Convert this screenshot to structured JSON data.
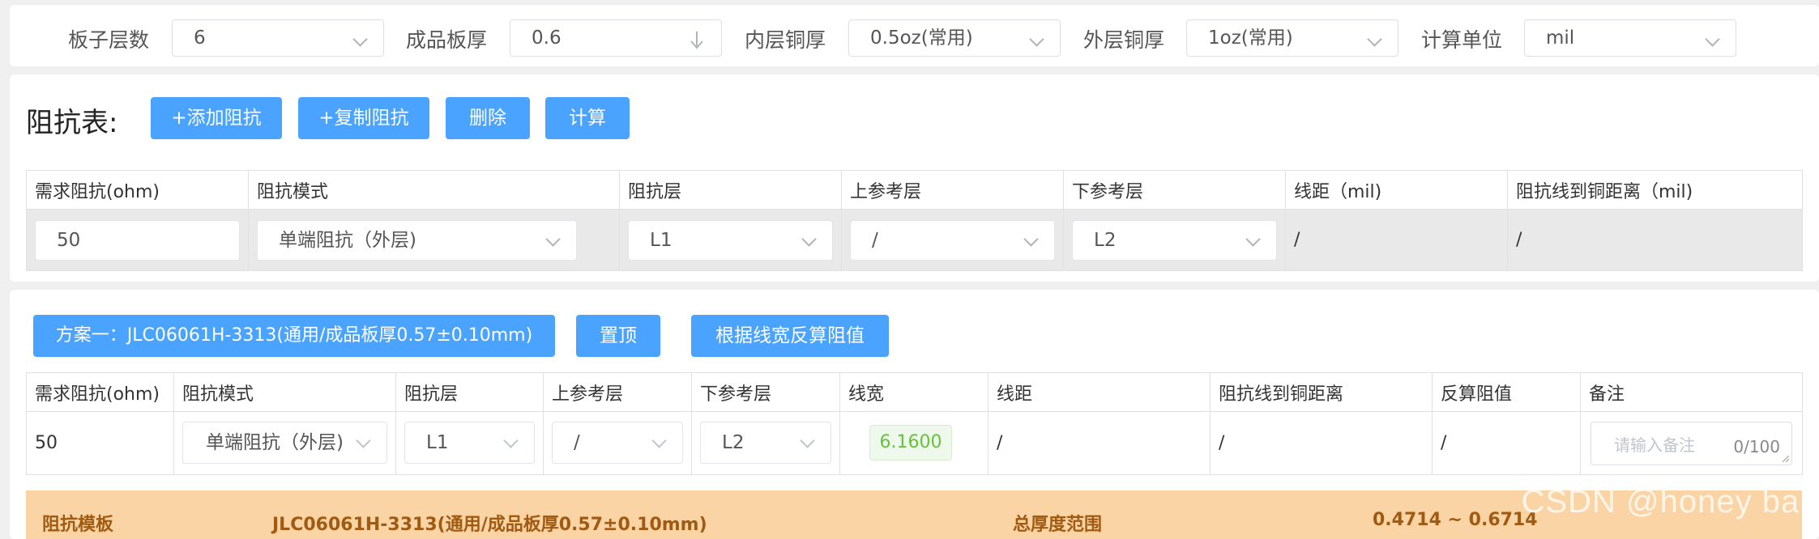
{
  "settings": [
    {
      "label": "板子层数",
      "value": "6"
    },
    {
      "label": "成品板厚",
      "value": "0.6"
    },
    {
      "label": "内层铜厚",
      "value": "0.5oz(常用)"
    },
    {
      "label": "外层铜厚",
      "value": "1oz(常用)"
    },
    {
      "label": "计算单位",
      "value": "mil"
    }
  ],
  "impedance_table": {
    "title": "阻抗表:",
    "buttons": {
      "add": "+添加阻抗",
      "copy": "+复制阻抗",
      "delete": "删除",
      "calc": "计算"
    },
    "headers": [
      "需求阻抗(ohm)",
      "阻抗模式",
      "阻抗层",
      "上参考层",
      "下参考层",
      "线距（mil)",
      "阻抗线到铜距离（mil)"
    ],
    "row": {
      "impedance": "50",
      "mode": "单端阻抗（外层)",
      "layer": "L1",
      "upper_ref": "/",
      "lower_ref": "L2",
      "spacing": "/",
      "copper_distance": "/"
    }
  },
  "result": {
    "plan_button": "方案一：JLC06061H-3313(通用/成品板厚0.57±0.10mm)",
    "pin_button": "置顶",
    "reverse_button": "根据线宽反算阻值",
    "headers": [
      "需求阻抗(ohm)",
      "阻抗模式",
      "阻抗层",
      "上参考层",
      "下参考层",
      "线宽",
      "线距",
      "阻抗线到铜距离",
      "反算阻值",
      "备注"
    ],
    "row": {
      "impedance": "50",
      "mode": "单端阻抗（外层)",
      "layer": "L1",
      "upper_ref": "/",
      "lower_ref": "L2",
      "width": "6.1600",
      "spacing": "/",
      "copper_distance": "/",
      "reverse_value": "/",
      "remark_placeholder": "请输入备注",
      "remark_counter": "0/100"
    }
  },
  "template_bar": {
    "label": "阻抗模板",
    "value": "JLC06061H-3313(通用/成品板厚0.57±0.10mm)",
    "range_label": "总厚度范围",
    "range_value": "0.4714 ~ 0.6714"
  },
  "watermark": "CSDN @honey ball",
  "colors": {
    "primary": "#4aa3ff",
    "template_bar_bg": "#fad4a4",
    "template_bar_text": "#a05a12",
    "width_badge": "#67c23a"
  },
  "icons": [
    "chevron-down-icon",
    "arrow-down-icon"
  ]
}
